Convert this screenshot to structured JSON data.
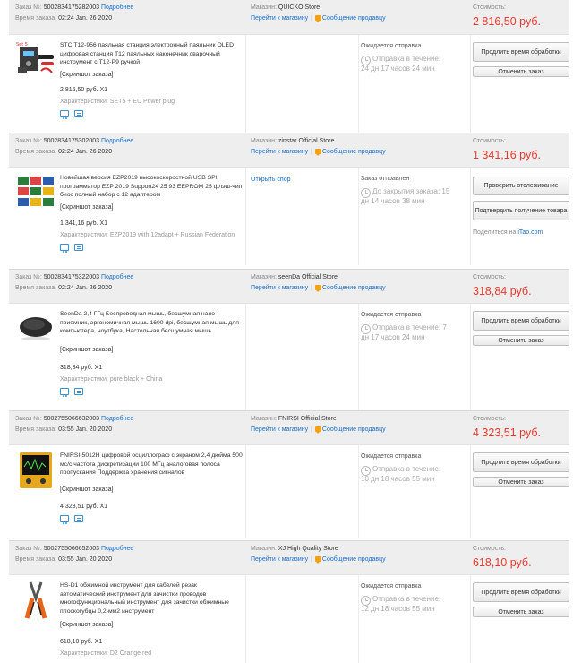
{
  "labels": {
    "order_no": "Заказ №:",
    "details": "Подробнее",
    "order_time": "Время заказа:",
    "store": "Магазин:",
    "go_to_store": "Перейти к магазину",
    "message_seller": "Сообщение продавцу",
    "cost": "Стоимость:",
    "screenshot": "[Скриншот заказа]",
    "characteristics": "Характеристики:",
    "extend_processing": "Продлить время обработки",
    "cancel_order": "Отменить заказ",
    "open_dispute": "Открыть спор",
    "check_tracking": "Проверить отслеживание",
    "confirm_receipt": "Подтвердить получение товара",
    "share_prefix": "Поделиться на",
    "share_site": "iTao.com"
  },
  "icons": {
    "message": "message-icon",
    "clock": "clock-icon",
    "cart": "cart-icon",
    "snapshot": "snapshot-icon"
  },
  "colors": {
    "accent_blue": "#1a6fc9",
    "price_red": "#e8392c",
    "message_orange": "#f3a218",
    "header_gray": "#eeeeee"
  },
  "orders": [
    {
      "number": "5002834175282003",
      "time": "02:24 Jan. 26 2020",
      "store": "QUICKO Store",
      "cost": "2 816,50 руб.",
      "title": "STC T12-956 паяльная станция электронный паяльник OLED цифровая станция T12 паяльных наконечник сварочный инструмент с T12-P9 ручкой",
      "price_qty": "2 816,50 руб. X1",
      "chars": "SET5 + EU Power plug",
      "status": "Ожидается отправка",
      "timer_prefix": "Отправка в течение:",
      "timer": "24 дн 17 часов 24 мин"
    },
    {
      "number": "5002834175302003",
      "time": "02:24 Jan. 26 2020",
      "store": "zinstar Official Store",
      "cost": "1 341,16 руб.",
      "title": "Новейшая версия EZP2019 высокоскоростной USB SPI программатор EZP 2019 Support24 25 93 EEPROM 25 флэш-чип биос полный набор с 12 адаптером",
      "price_qty": "1 341,16 руб. X1",
      "chars": "EZP2019 with 12adapt + Russian Federation",
      "status": "Заказ отправлен",
      "timer_prefix": "До закрытия заказа: 15",
      "timer": "дн 14 часов 38 мин"
    },
    {
      "number": "5002834175322003",
      "time": "02:24 Jan. 26 2020",
      "store": "seenDa Official Store",
      "cost": "318,84 руб.",
      "title": "SeenDa 2,4 ГГц Беспроводная мышь, бесшумная нано-приемник, эргономичная мышь 1600 dpi, бесшумная мышь для компьютера, ноутбука, Настольная бесшумная мышь",
      "price_qty": "318,84 руб. X1",
      "chars": "pure black + China",
      "status": "Ожидается отправка",
      "timer_prefix": "Отправка в течение: 7",
      "timer": "дн 17 часов 24 мин"
    },
    {
      "number": "5002755066632003",
      "time": "03:55 Jan. 20 2020",
      "store": "FNIRSI Official Store",
      "cost": "4 323,51 руб.",
      "title": "FNIRSI-5012H цифровой осциллограф с экраном 2,4 дюйма 500 мс/с частота дискретизации 100 МГц аналоговая полоса пропускания Поддержка хранения сигналов",
      "price_qty": "4 323,51 руб. X1",
      "chars": "",
      "status": "Ожидается отправка",
      "timer_prefix": "Отправка в течение:",
      "timer": "10 дн 18 часов 55 мин"
    },
    {
      "number": "5002755066652003",
      "time": "03:55 Jan. 20 2020",
      "store": "XJ High Quality Store",
      "cost": "618,10 руб.",
      "title": "HS-D1 обжимной инструмент для кабелей резак автоматический инструмент для зачистки проводов многофункциональный инструмент для зачистки обжимные плоскогубцы 0,2-мм2 инструмент",
      "price_qty": "618,10 руб. X1",
      "chars": "D2 Orange red",
      "status": "Ожидается отправка",
      "timer_prefix": "Отправка в течение:",
      "timer": "12 дн 18 часов 55 мин"
    }
  ]
}
